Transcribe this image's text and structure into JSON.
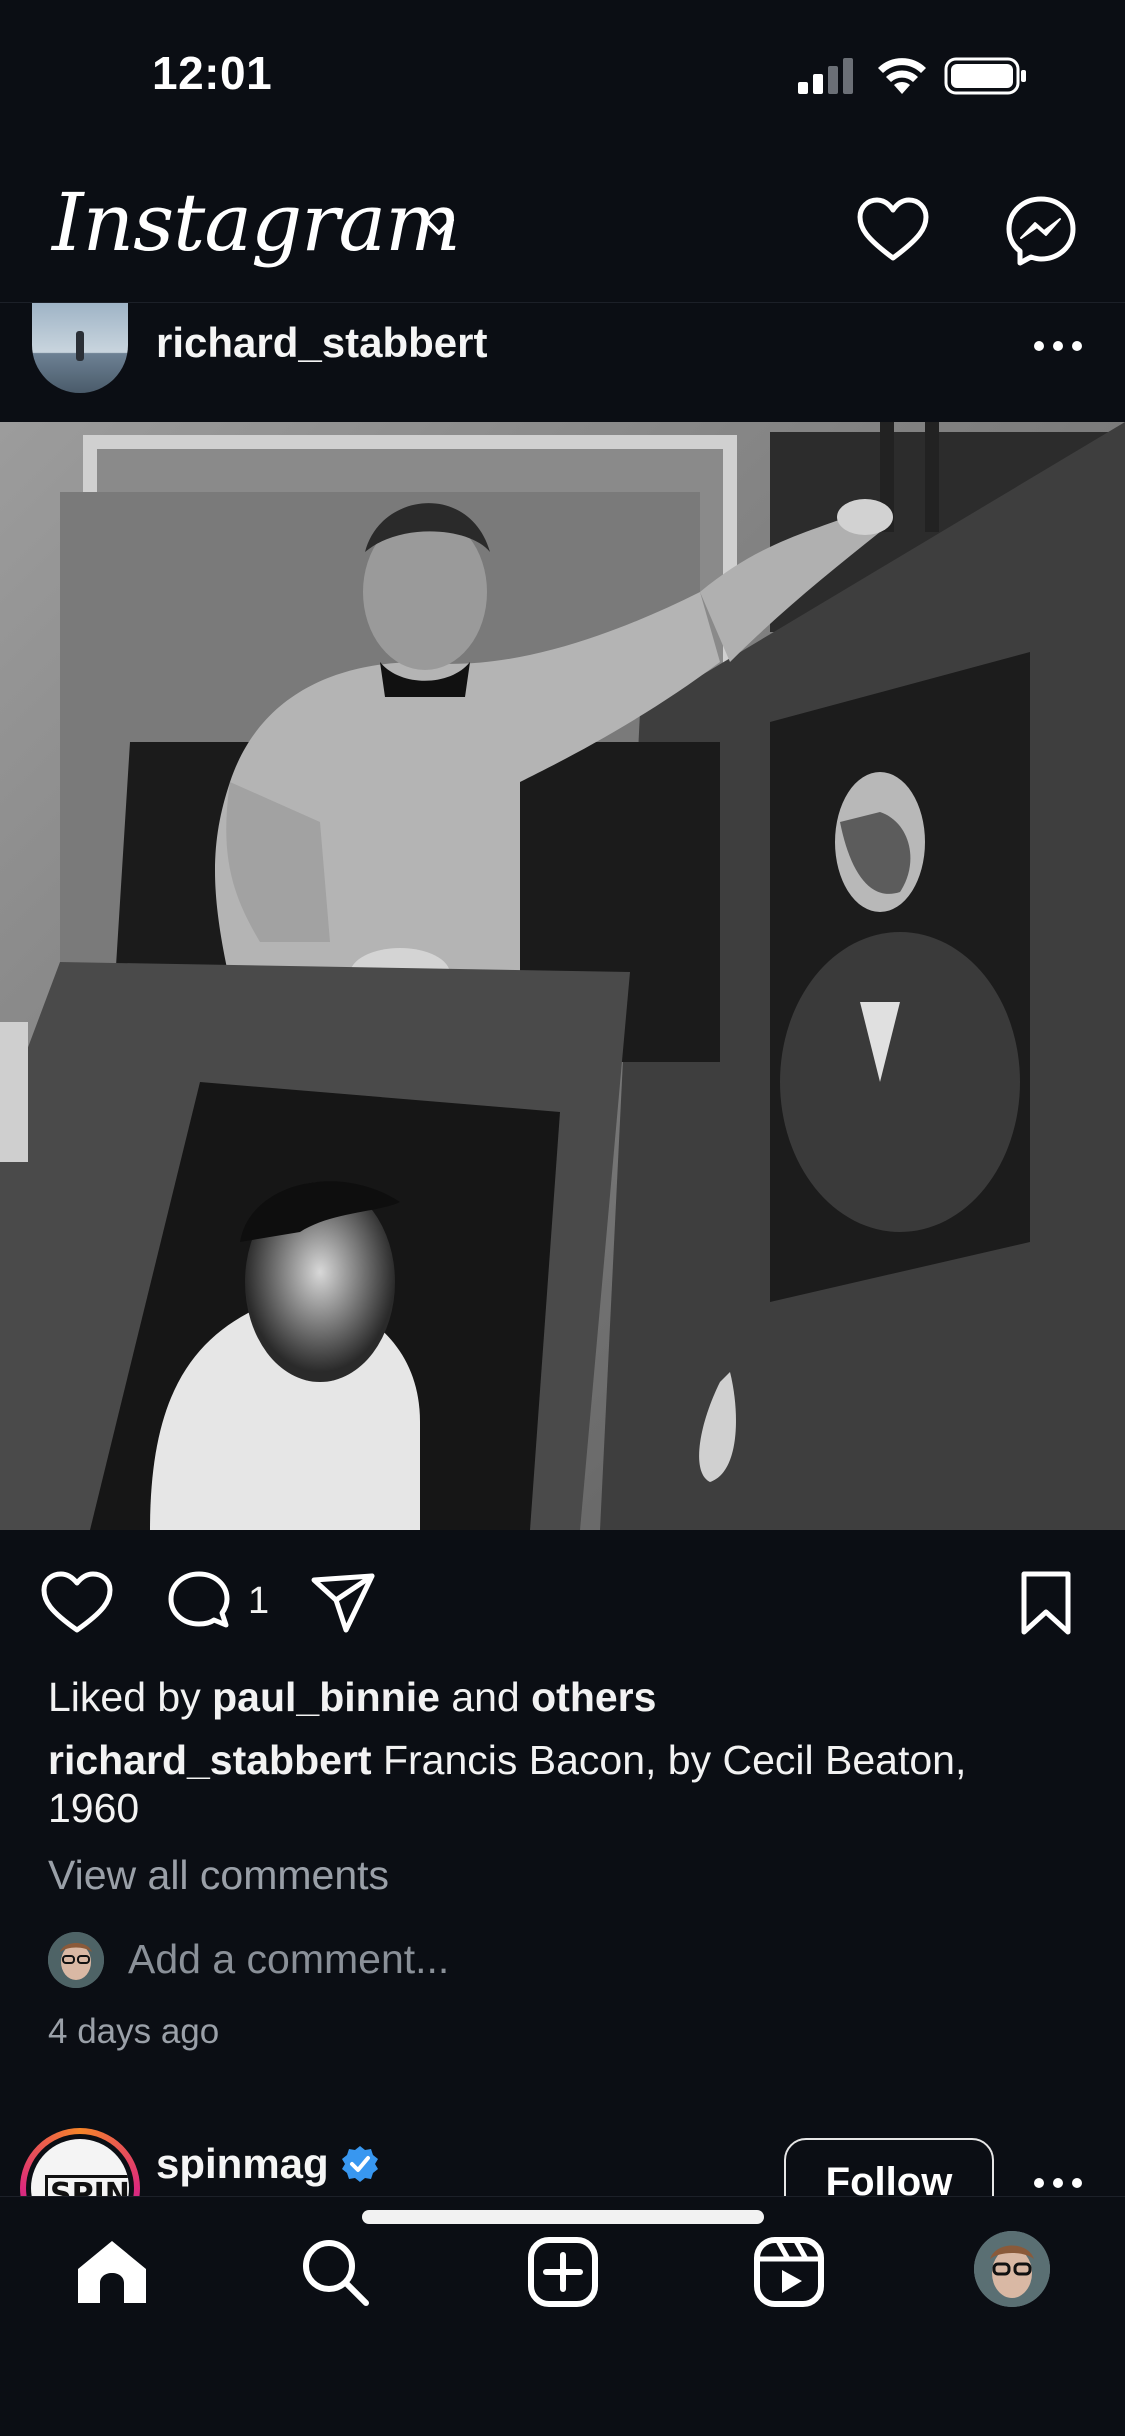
{
  "status_bar": {
    "time": "12:01"
  },
  "header": {
    "logo_text": "Instagram"
  },
  "post": {
    "username": "richard_stabbert",
    "comment_count": "1",
    "liked_prefix": "Liked by ",
    "liked_user": "paul_binnie",
    "liked_middle": " and ",
    "liked_suffix": "others",
    "caption_username": "richard_stabbert",
    "caption_text": " Francis Bacon, by Cecil Beaton, 1960",
    "view_all_comments": "View all comments",
    "add_comment_placeholder": "Add a comment...",
    "time_ago": "4 days ago"
  },
  "next_post": {
    "username": "spinmag",
    "avatar_text": "SPIN",
    "follow_label": "Follow"
  },
  "colors": {
    "background": "#0b0e14",
    "text": "#f2f2f2",
    "muted": "#9aa0a8",
    "verified": "#3897f0"
  },
  "icons": {
    "header": [
      "chevron-down-icon",
      "heart-icon",
      "messenger-icon"
    ],
    "actions": [
      "heart-icon",
      "comment-icon",
      "share-icon",
      "bookmark-icon"
    ],
    "nav": [
      "home-icon",
      "search-icon",
      "create-icon",
      "reels-icon",
      "profile-avatar"
    ]
  }
}
